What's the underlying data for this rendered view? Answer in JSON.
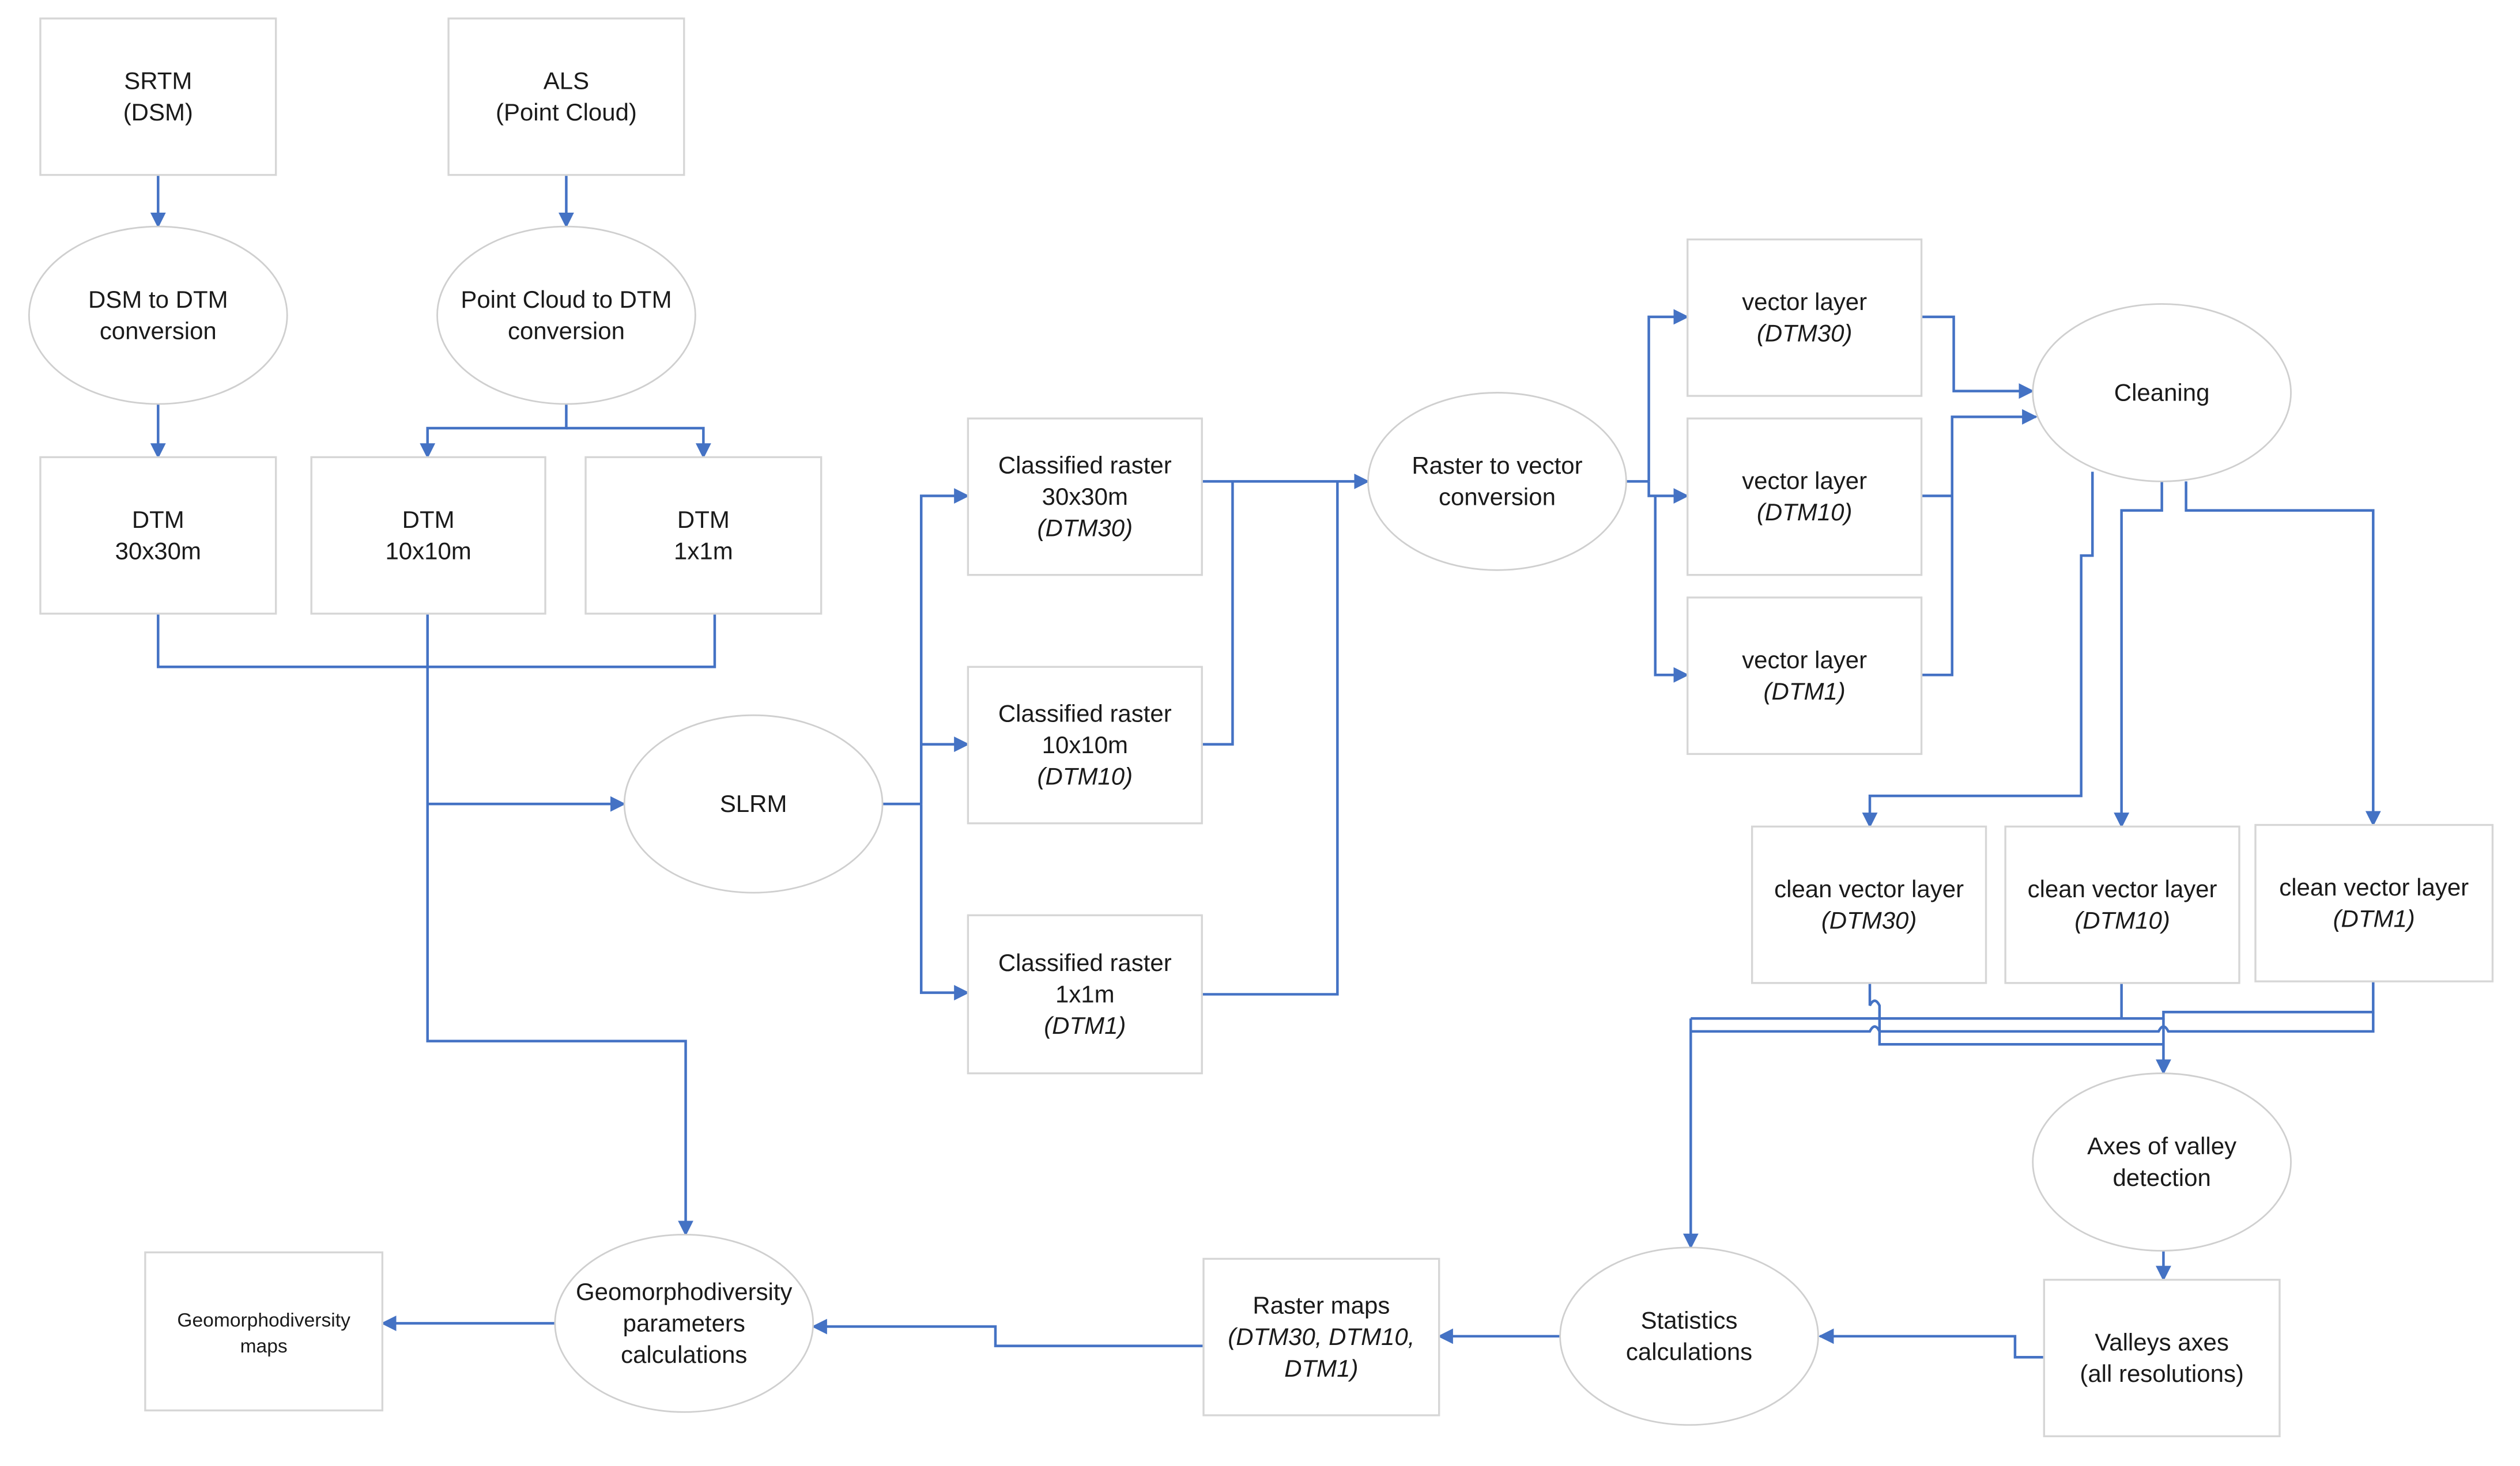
{
  "diagram": {
    "line_color": "#4472c4",
    "nodes": {
      "srtm": {
        "lines": [
          "SRTM",
          "(DSM)"
        ]
      },
      "als": {
        "lines": [
          "ALS",
          "(Point Cloud)"
        ]
      },
      "dsm_to_dtm": {
        "lines": [
          "DSM to DTM",
          "conversion"
        ]
      },
      "pc_to_dtm": {
        "lines": [
          "Point Cloud to DTM",
          "conversion"
        ]
      },
      "dtm30": {
        "lines": [
          "DTM",
          "30x30m"
        ]
      },
      "dtm10": {
        "lines": [
          "DTM",
          "10x10m"
        ]
      },
      "dtm1": {
        "lines": [
          "DTM",
          "1x1m"
        ]
      },
      "slrm": {
        "lines": [
          "SLRM"
        ]
      },
      "class30": {
        "lines": [
          "Classified raster",
          "30x30m"
        ],
        "italic": "(DTM30)"
      },
      "class10": {
        "lines": [
          "Classified raster",
          "10x10m"
        ],
        "italic": "(DTM10)"
      },
      "class1": {
        "lines": [
          "Classified raster",
          "1x1m"
        ],
        "italic": "(DTM1)"
      },
      "r2v": {
        "lines": [
          "Raster to vector",
          "conversion"
        ]
      },
      "vec30": {
        "lines": [
          "vector layer"
        ],
        "italic": "(DTM30)"
      },
      "vec10": {
        "lines": [
          "vector layer"
        ],
        "italic": "(DTM10)"
      },
      "vec1": {
        "lines": [
          "vector layer"
        ],
        "italic": "(DTM1)"
      },
      "cleaning": {
        "lines": [
          "Cleaning"
        ]
      },
      "clean30": {
        "lines": [
          "clean vector layer"
        ],
        "italic": "(DTM30)"
      },
      "clean10": {
        "lines": [
          "clean vector layer"
        ],
        "italic": "(DTM10)"
      },
      "clean1": {
        "lines": [
          "clean vector layer"
        ],
        "italic": "(DTM1)"
      },
      "axes_detect": {
        "lines": [
          "Axes of valley",
          "detection"
        ]
      },
      "valleys_axes": {
        "lines": [
          "Valleys axes",
          "(all resolutions)"
        ]
      },
      "stats": {
        "lines": [
          "Statistics",
          "calculations"
        ]
      },
      "raster_maps": {
        "lines": [
          "Raster maps"
        ],
        "italic_lines": [
          "(DTM30, DTM10,",
          "DTM1)"
        ]
      },
      "geo_params": {
        "lines": [
          "Geomorphodiversity",
          "parameters",
          "calculations"
        ]
      },
      "geo_maps": {
        "lines": [
          "Geomorphodiversity",
          "maps"
        ]
      }
    },
    "edges": [
      [
        "srtm",
        "dsm_to_dtm"
      ],
      [
        "als",
        "pc_to_dtm"
      ],
      [
        "dsm_to_dtm",
        "dtm30"
      ],
      [
        "pc_to_dtm",
        "dtm10"
      ],
      [
        "pc_to_dtm",
        "dtm1"
      ],
      [
        "dtm30",
        "slrm"
      ],
      [
        "dtm10",
        "slrm"
      ],
      [
        "dtm1",
        "slrm"
      ],
      [
        "dtm10",
        "geo_params"
      ],
      [
        "slrm",
        "class30"
      ],
      [
        "slrm",
        "class10"
      ],
      [
        "slrm",
        "class1"
      ],
      [
        "class30",
        "r2v"
      ],
      [
        "class10",
        "r2v"
      ],
      [
        "class1",
        "r2v"
      ],
      [
        "r2v",
        "vec30"
      ],
      [
        "r2v",
        "vec10"
      ],
      [
        "r2v",
        "vec1"
      ],
      [
        "vec30",
        "cleaning"
      ],
      [
        "vec10",
        "cleaning"
      ],
      [
        "vec1",
        "cleaning"
      ],
      [
        "cleaning",
        "clean30"
      ],
      [
        "cleaning",
        "clean10"
      ],
      [
        "cleaning",
        "clean1"
      ],
      [
        "clean30",
        "axes_detect"
      ],
      [
        "clean10",
        "axes_detect"
      ],
      [
        "clean1",
        "axes_detect"
      ],
      [
        "clean30",
        "stats"
      ],
      [
        "clean10",
        "stats"
      ],
      [
        "clean1",
        "stats"
      ],
      [
        "axes_detect",
        "valleys_axes"
      ],
      [
        "valleys_axes",
        "stats"
      ],
      [
        "stats",
        "raster_maps"
      ],
      [
        "raster_maps",
        "geo_params"
      ],
      [
        "geo_params",
        "geo_maps"
      ]
    ]
  }
}
